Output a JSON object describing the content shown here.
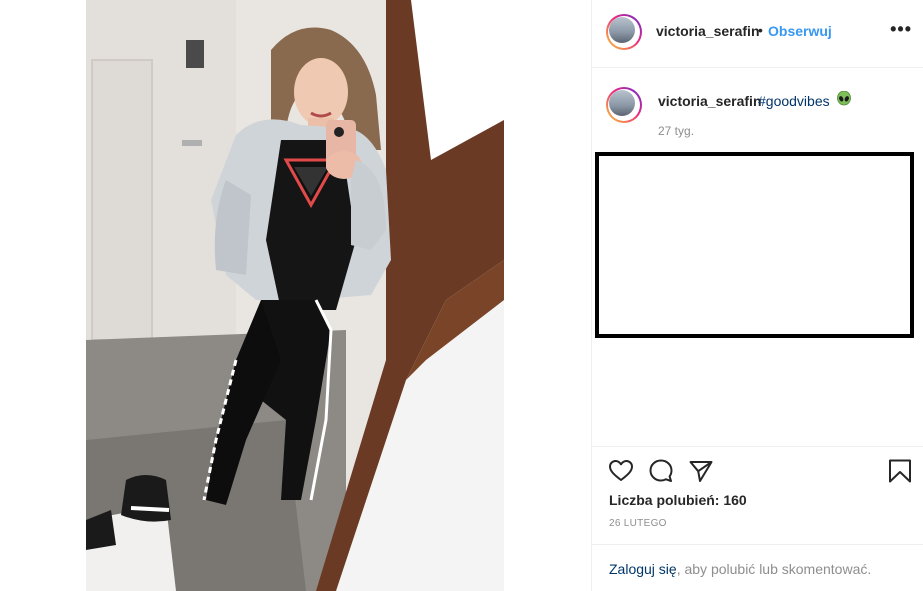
{
  "post": {
    "username": "victoria_serafin",
    "follow_label": "Obserwuj",
    "separator": "•",
    "more_label": "•••"
  },
  "caption": {
    "username": "victoria_serafin",
    "hashtag": "#goodvibes",
    "emoji_icon": "alien-emoji-icon",
    "time_ago": "27 tyg."
  },
  "actions": {
    "icons": [
      "heart-icon",
      "comment-icon",
      "share-icon",
      "bookmark-icon"
    ],
    "likes_text": "Liczba polubień: 160",
    "date": "26 LUTEGO"
  },
  "login": {
    "link_text": "Zaloguj się",
    "rest_text": ", aby polubić lub skomentować."
  },
  "colors": {
    "link_blue": "#3897f0",
    "hashtag_blue": "#003569",
    "text": "#262626",
    "muted": "#8e8e8e",
    "border": "#efefef"
  }
}
